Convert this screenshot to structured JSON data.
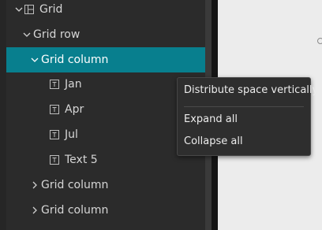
{
  "tree": {
    "items": [
      {
        "label": "Grid",
        "icon": "grid-layout-icon",
        "expanded": true
      },
      {
        "label": "Grid row",
        "expanded": true
      },
      {
        "label": "Grid column",
        "expanded": true,
        "selected": true
      },
      {
        "label": "Jan",
        "icon": "text-widget-icon"
      },
      {
        "label": "Apr",
        "icon": "text-widget-icon"
      },
      {
        "label": "Jul",
        "icon": "text-widget-icon"
      },
      {
        "label": "Text 5",
        "icon": "text-widget-icon"
      },
      {
        "label": "Grid column",
        "expanded": false
      },
      {
        "label": "Grid column",
        "expanded": false
      }
    ]
  },
  "context_menu": {
    "items": [
      "Distribute space vertically",
      "Expand all",
      "Collapse all"
    ]
  },
  "colors": {
    "selected_row": "#087f8e",
    "panel_bg": "#2b2b2b",
    "canvas_bg": "#ececec"
  }
}
